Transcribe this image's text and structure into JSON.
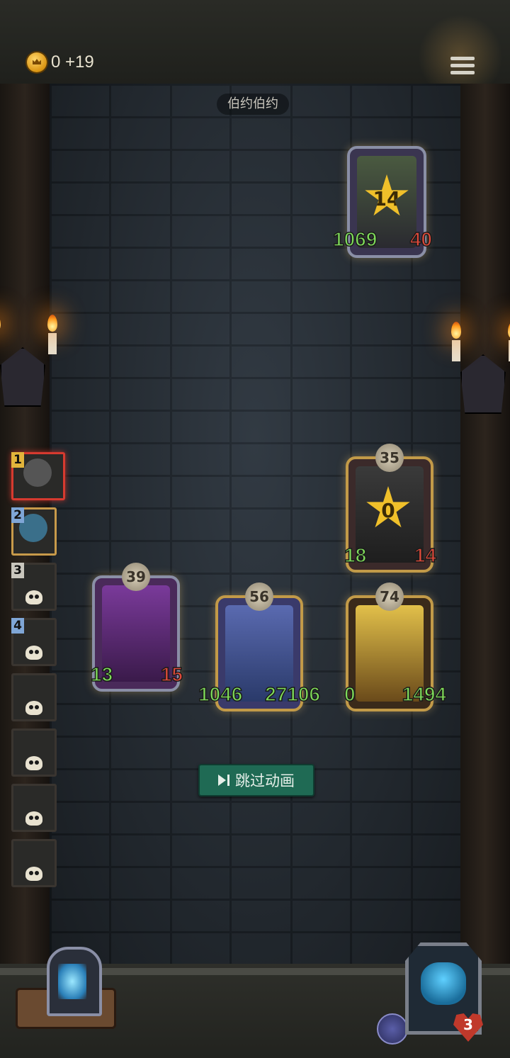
{
  "header": {
    "gold_amount": "0",
    "gold_gain": "+19"
  },
  "location_label": "伯约伯约",
  "enemy": {
    "atk": "1069",
    "hp": "40",
    "star_value": "14"
  },
  "board": {
    "top_right": {
      "level": "35",
      "atk": "18",
      "hp": "14",
      "star_value": "0"
    },
    "row": [
      {
        "level": "39",
        "atk": "13",
        "hp": "15"
      },
      {
        "level": "56",
        "atk": "1046",
        "hp": "27106"
      },
      {
        "level": "74",
        "atk": "0",
        "hp": "1494"
      }
    ]
  },
  "turn_queue": [
    "1",
    "2",
    "3",
    "4",
    "",
    "",
    "",
    ""
  ],
  "skip_button_label": "跳过动画",
  "player": {
    "lives": "3"
  }
}
